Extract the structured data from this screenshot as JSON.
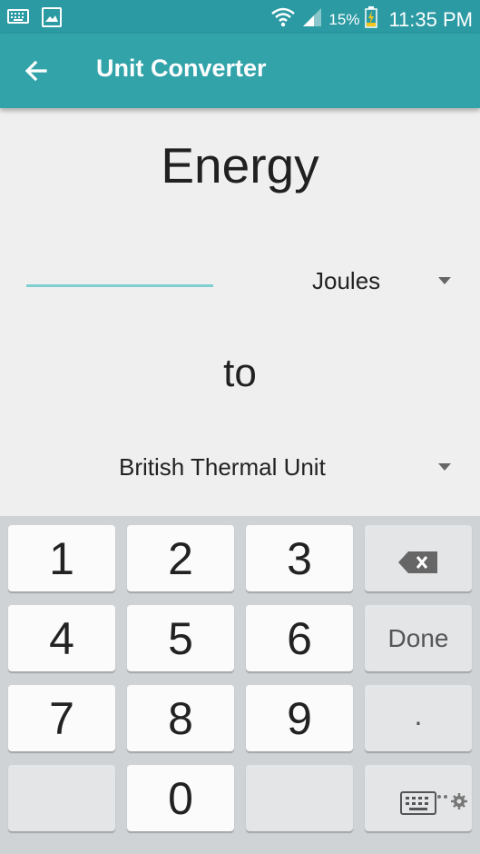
{
  "status_bar": {
    "battery_percent": "15%",
    "time": "11:35 PM",
    "icons": [
      "keyboard-icon",
      "image-icon",
      "wifi-icon",
      "signal-icon",
      "battery-icon"
    ]
  },
  "app_bar": {
    "title": "Unit Converter",
    "background": "#31a3a9"
  },
  "content": {
    "heading": "Energy",
    "input_value": "",
    "from_unit": "Joules",
    "to_label": "to",
    "to_unit": "British Thermal Unit",
    "accent": "#7ed0d0"
  },
  "keyboard": {
    "keys": [
      "1",
      "2",
      "3",
      "4",
      "5",
      "6",
      "7",
      "8",
      "9",
      "0"
    ],
    "done_label": "Done",
    "dot_label": "."
  }
}
